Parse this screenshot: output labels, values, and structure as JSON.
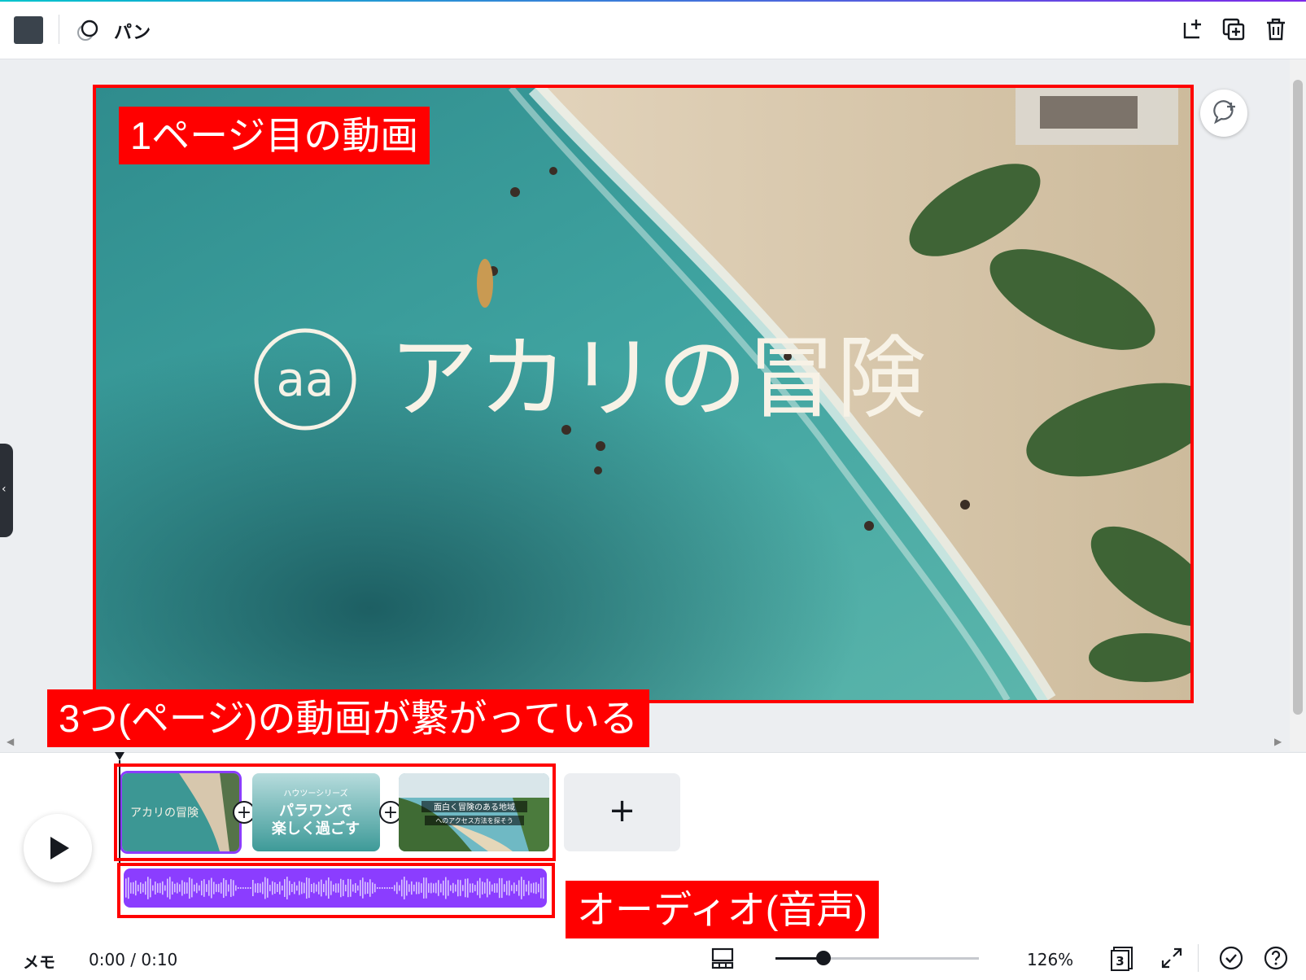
{
  "toolbar": {
    "effect_label": "パン",
    "icons": [
      "color-swatch",
      "pan-animation-icon",
      "add-page-icon",
      "duplicate-page-icon",
      "trash-icon"
    ]
  },
  "slide": {
    "title_logo_text": "aa",
    "title_text": "アカリの冒険"
  },
  "annotations": {
    "page1": "1ページ目の動画",
    "joined": "3つ(ページ)の動画が繋がっている",
    "audio": "オーディオ(音声)"
  },
  "timeline": {
    "clips": [
      {
        "caption": "アカリの冒険"
      },
      {
        "subtitle": "ハウツーシリーズ",
        "caption_line1": "パラワンで",
        "caption_line2": "楽しく過ごす"
      },
      {
        "caption_line1": "面白く冒険のある地域",
        "caption_line2": "へのアクセス方法を探そう"
      }
    ],
    "add_clip_symbol": "+",
    "add_page_symbol": "+"
  },
  "bottom_bar": {
    "memo_label": "メモ",
    "time": "0:00 / 0:10",
    "zoom": "126%",
    "page_count": "3"
  },
  "colors": {
    "annotation_red": "#ff0000",
    "accent_purple": "#8b3dff",
    "text_dark": "#16191f"
  }
}
